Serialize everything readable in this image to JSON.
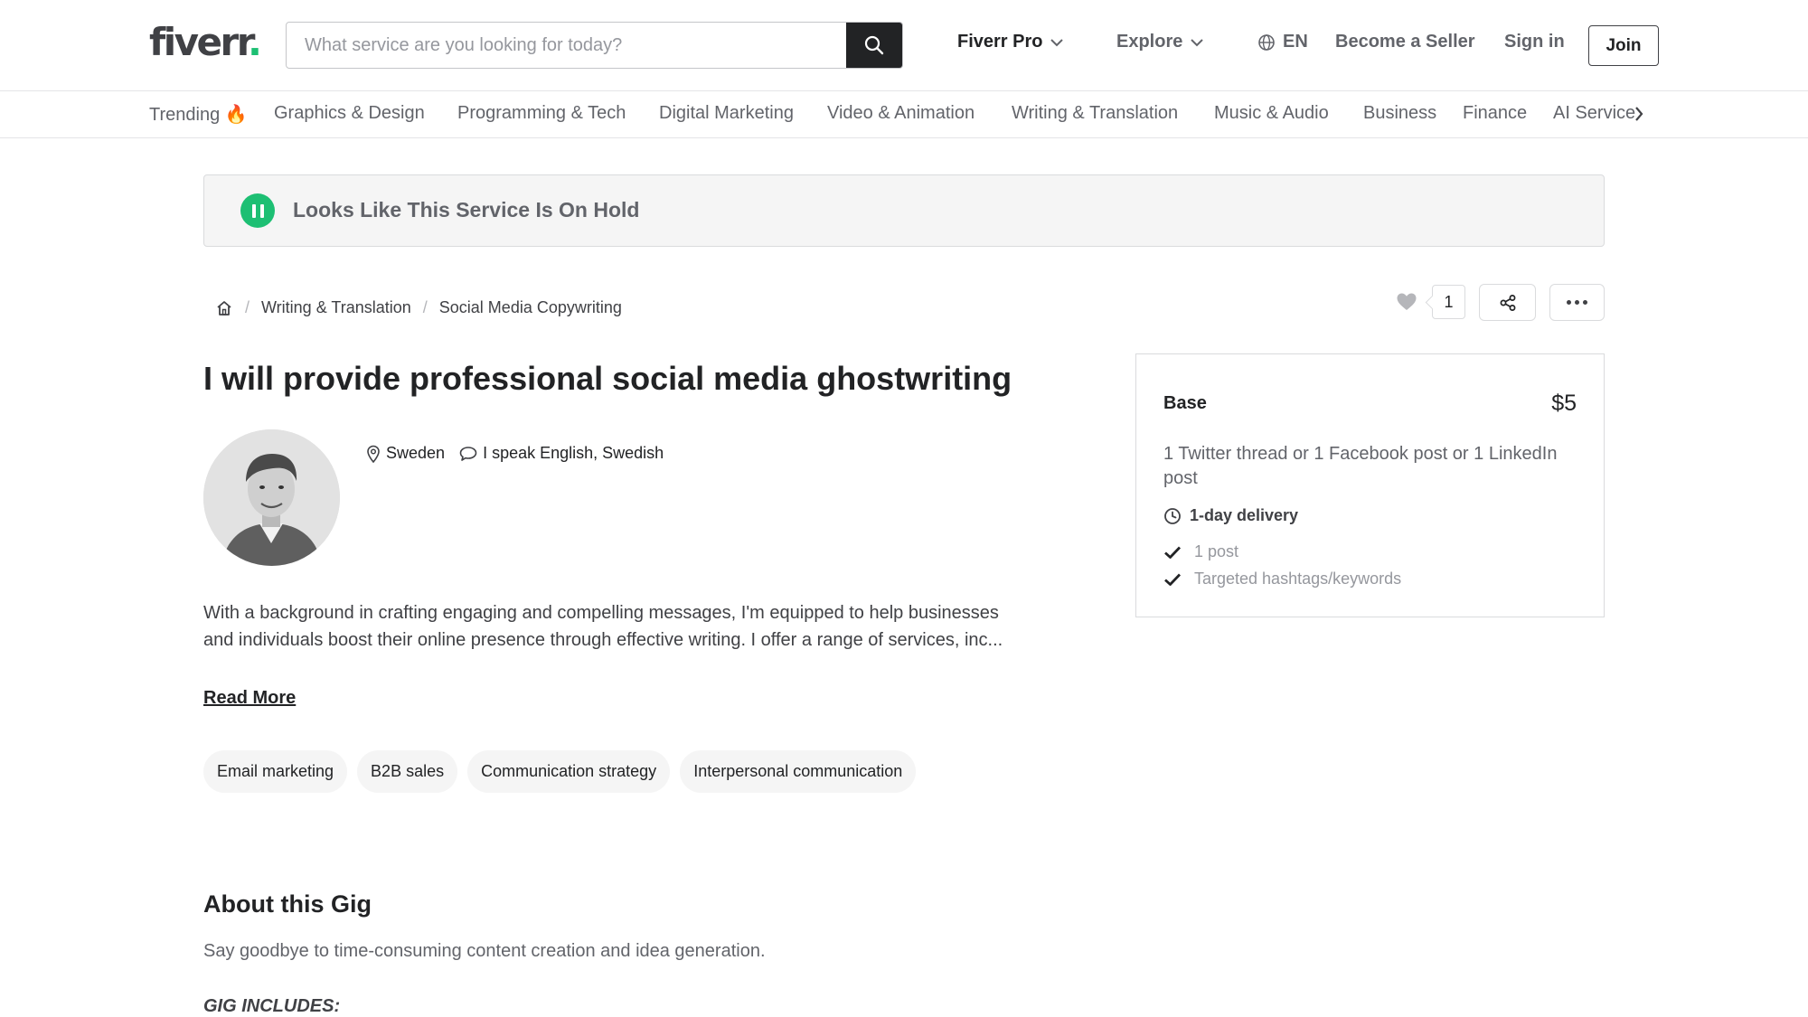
{
  "header": {
    "logo_text": "fiverr",
    "logo_dot": ".",
    "search_placeholder": "What service are you looking for today?",
    "nav": {
      "pro": "Fiverr Pro",
      "explore": "Explore",
      "language": "EN",
      "become_seller": "Become a Seller",
      "sign_in": "Sign in",
      "join": "Join"
    }
  },
  "categories": [
    "Trending 🔥",
    "Graphics & Design",
    "Programming & Tech",
    "Digital Marketing",
    "Video & Animation",
    "Writing & Translation",
    "Music & Audio",
    "Business",
    "Finance",
    "AI Services"
  ],
  "banner": {
    "text": "Looks Like This Service Is On Hold"
  },
  "breadcrumb": {
    "items": [
      "Writing & Translation",
      "Social Media Copywriting"
    ]
  },
  "actions": {
    "like_count": "1"
  },
  "gig": {
    "title": "I will provide professional social media ghostwriting",
    "location": "Sweden",
    "languages": "I speak English, Swedish",
    "description": "With a background in crafting engaging and compelling messages, I'm equipped to help businesses and individuals boost their online presence through effective writing. I offer a range of services, inc...",
    "read_more": "Read More",
    "tags": [
      "Email marketing",
      "B2B sales",
      "Communication strategy",
      "Interpersonal communication"
    ]
  },
  "about": {
    "heading": "About this Gig",
    "text": "Say goodbye to time-consuming content creation and idea generation.",
    "includes": "GIG INCLUDES:"
  },
  "package": {
    "name": "Base",
    "price": "$5",
    "description": "1 Twitter thread or 1 Facebook post or 1 LinkedIn post",
    "delivery": "1-day delivery",
    "features": [
      "1 post",
      "Targeted hashtags/keywords"
    ]
  },
  "colors": {
    "brand_green": "#1dbf73",
    "text_dark": "#222325",
    "text_muted": "#62646a"
  }
}
